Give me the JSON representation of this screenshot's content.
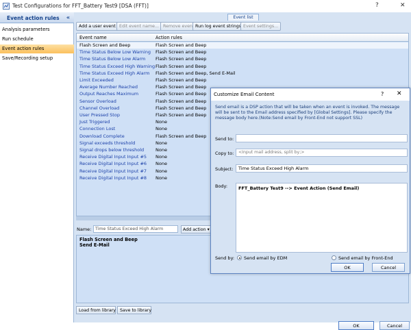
{
  "window": {
    "title": "Test Configurations for FFT_Battery Test9 [DSA (FFT)]",
    "help": "?",
    "close": "✕"
  },
  "nav": {
    "header": "Event action rules",
    "collapse": "«",
    "items": [
      {
        "label": "Analysis parameters"
      },
      {
        "label": "Run schedule"
      },
      {
        "label": "Event action rules",
        "selected": true
      },
      {
        "label": "Save/Recording setup"
      }
    ]
  },
  "event_list": {
    "tab_label": "Event list",
    "toolbar": {
      "add": "Add a user event",
      "edit": "Edit event name...",
      "remove": "Remove event",
      "run_log": "Run log event strings",
      "settings": "Event settings..."
    },
    "columns": {
      "name": "Event name",
      "action": "Action rules"
    },
    "rows": [
      {
        "name": "Flash Screen and Beep",
        "action": "Flash Screen and Beep"
      },
      {
        "name": "Time Status Below Low Warning",
        "action": "Flash Screen and Beep"
      },
      {
        "name": "Time Status Below Low Alarm",
        "action": "Flash Screen and Beep"
      },
      {
        "name": "Time Status Exceed High Warning",
        "action": "Flash Screen and Beep"
      },
      {
        "name": "Time Status Exceed High Alarm",
        "action": "Flash Screen and Beep, Send E-Mail"
      },
      {
        "name": "Limit Exceeded",
        "action": "Flash Screen and Beep"
      },
      {
        "name": "Average Number Reached",
        "action": "Flash Screen and Beep"
      },
      {
        "name": "Output Reaches Maximum",
        "action": "Flash Screen and Beep"
      },
      {
        "name": "Sensor Overload",
        "action": "Flash Screen and Beep"
      },
      {
        "name": "Channel Overload",
        "action": "Flash Screen and Beep"
      },
      {
        "name": "User Pressed Stop",
        "action": "Flash Screen and Beep"
      },
      {
        "name": "Just Triggered",
        "action": "None"
      },
      {
        "name": "Connection Lost",
        "action": "None"
      },
      {
        "name": "Download Complete",
        "action": "Flash Screen and Beep"
      },
      {
        "name": "Signal exceeds threshold",
        "action": "None"
      },
      {
        "name": "Signal drops below threshold",
        "action": "None"
      },
      {
        "name": "Receive Digital Input Input #5",
        "action": "None"
      },
      {
        "name": "Receive Digital Input Input #6",
        "action": "None"
      },
      {
        "name": "Receive Digital Input Input #7",
        "action": "None"
      },
      {
        "name": "Receive Digital Input Input #8",
        "action": "None"
      }
    ]
  },
  "editor": {
    "name_label": "Name:",
    "name_value": "Time Status Exceed High Alarm",
    "add_action": "Add action ▾",
    "actions": [
      "Flash Screen and Beep",
      "Send E-Mail"
    ],
    "load_library": "Load from library",
    "save_library": "Save to library"
  },
  "footer": {
    "ok": "OK",
    "cancel": "Cancel"
  },
  "dialog": {
    "title": "Customize Email Content",
    "help": "?",
    "close": "✕",
    "description": "Send email is a DSP action that will be taken when an event is invoked. The message will be sent to the Email address specified by [Global Settings]. Please specify the message body here.(Note:Send email by Front-End not support SSL)",
    "send_to_label": "Send to:",
    "send_to_value": "",
    "copy_to_label": "Copy to:",
    "copy_to_placeholder": "<Input mail address, split by;>",
    "subject_label": "Subject:",
    "subject_value": "Time Status Exceed High Alarm",
    "body_label": "Body:",
    "body_value": "FFT_Battery Test9 --> Event Action (Send Email)",
    "send_by_label": "Send by:",
    "send_by_options": [
      {
        "label": "Send email by EDM",
        "selected": true
      },
      {
        "label": "Send email by Front-End",
        "selected": false
      }
    ],
    "ok": "OK",
    "cancel": "Cancel"
  }
}
